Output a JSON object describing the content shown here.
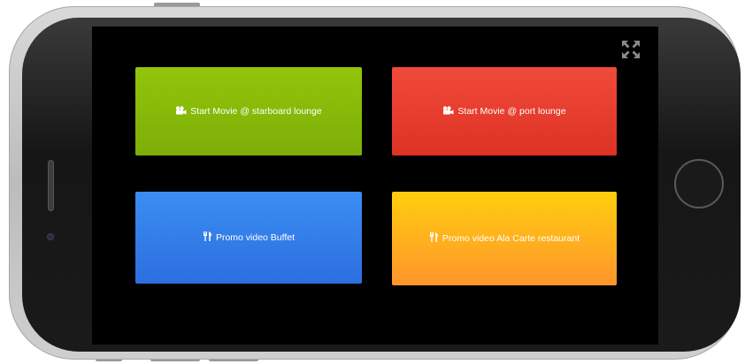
{
  "tiles": [
    {
      "label": "Start Movie @ starboard lounge",
      "icon": "video-camera-icon",
      "color_top": "#93c50a",
      "color_bottom": "#7cae08"
    },
    {
      "label": "Start Movie @ port lounge",
      "icon": "video-camera-icon",
      "color_top": "#f04a3a",
      "color_bottom": "#dd3224"
    },
    {
      "label": "Promo video Buffet",
      "icon": "cutlery-icon",
      "color_top": "#3b8df2",
      "color_bottom": "#2c6fe0"
    },
    {
      "label": "Promo video Ala Carte restaurant",
      "icon": "cutlery-icon",
      "color_top": "#ffce0e",
      "color_bottom": "#ff952c"
    }
  ],
  "screen": {
    "background": "#000000",
    "fullscreen_icon": "fullscreen-icon"
  }
}
